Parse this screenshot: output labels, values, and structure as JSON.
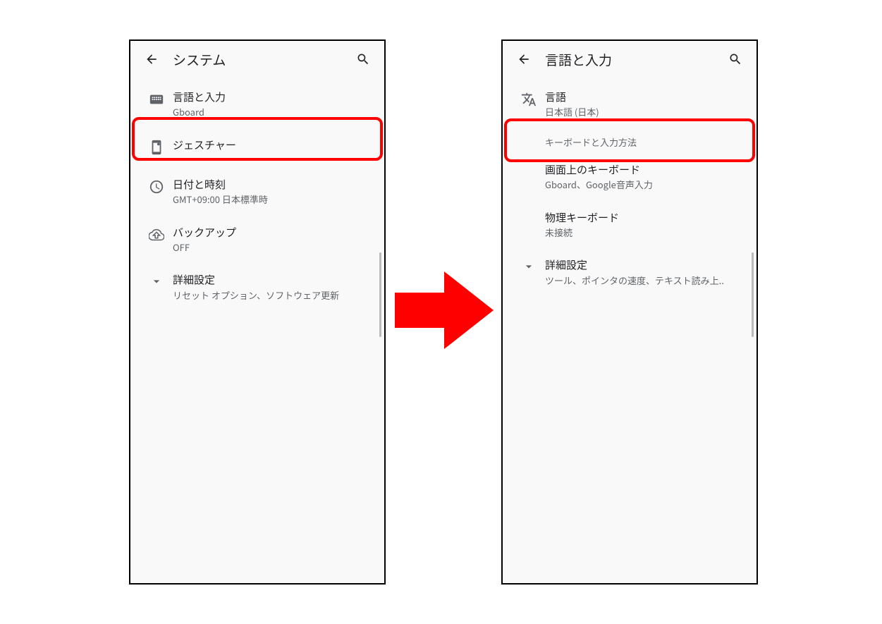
{
  "left": {
    "title": "システム",
    "items": [
      {
        "icon": "keyboard-icon",
        "label": "言語と入力",
        "sub": "Gboard"
      },
      {
        "icon": "gesture-icon",
        "label": "ジェスチャー",
        "sub": ""
      },
      {
        "icon": "clock-icon",
        "label": "日付と時刻",
        "sub": "GMT+09:00 日本標準時"
      },
      {
        "icon": "cloud-up-icon",
        "label": "バックアップ",
        "sub": "OFF"
      },
      {
        "icon": "chevron-down-icon",
        "label": "詳細設定",
        "sub": "リセット オプション、ソフトウェア更新"
      }
    ]
  },
  "right": {
    "title": "言語と入力",
    "items": [
      {
        "icon": "translate-icon",
        "label": "言語",
        "sub": "日本語 (日本)"
      }
    ],
    "section_label": "キーボードと入力方法",
    "items2": [
      {
        "label": "画面上のキーボード",
        "sub": "Gboard、Google音声入力"
      },
      {
        "label": "物理キーボード",
        "sub": "未接続"
      },
      {
        "icon": "chevron-down-icon",
        "label": "詳細設定",
        "sub": "ツール、ポインタの速度、テキスト読み上.."
      }
    ]
  },
  "highlight_color": "#ff0000"
}
